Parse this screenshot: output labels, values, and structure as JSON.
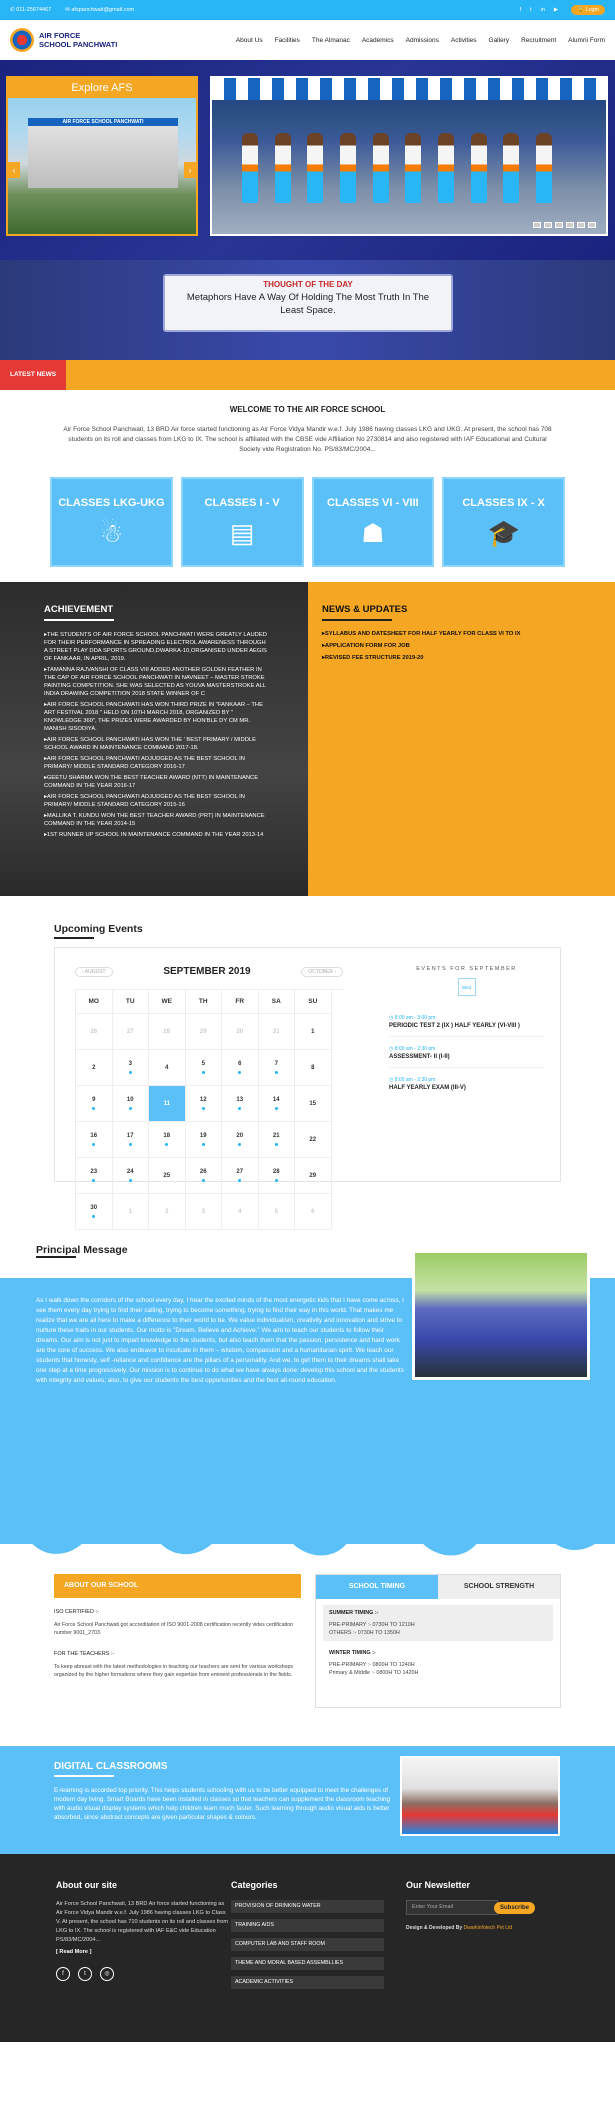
{
  "topbar": {
    "phone": "011-25674467",
    "email": "afspanchwati@gmail.com",
    "login": "Login"
  },
  "header": {
    "brand_line1": "AIR FORCE",
    "brand_line2": "SCHOOL PANCHWATI",
    "nav": [
      "About Us",
      "Facilities",
      "The Almanac",
      "Academics",
      "Admissions",
      "Activities",
      "Gallery",
      "Recruitment",
      "Alumni Form"
    ]
  },
  "hero": {
    "explore": "Explore AFS",
    "board": "AIR FORCE SCHOOL PANCHWATI"
  },
  "thought": {
    "heading": "THOUGHT OF THE DAY",
    "text": "Metaphors Have A Way Of Holding The Most Truth In The Least Space."
  },
  "latest_news": "LATEST NEWS",
  "welcome": {
    "title": "WELCOME TO THE AIR FORCE SCHOOL",
    "text": "Air Force School Panchwati, 13 BRD Air force started functioning as Air Force Vidya Mandir w.e.f. July 1986 having classes LKG and UKG. At present, the school has 708 students on its roll and classes from LKG to IX. The school is affiliated with the CBSE vide Affiliation No 2730814 and also registered with IAF Educational and Cultural Society vide Registration No. PS/83/MC/2004..."
  },
  "classes": [
    {
      "label": "CLASSES LKG-UKG",
      "icon": "☃"
    },
    {
      "label": "CLASSES I - V",
      "icon": "▤"
    },
    {
      "label": "CLASSES VI - VIII",
      "icon": "☗"
    },
    {
      "label": "CLASSES IX - X",
      "icon": "🎓"
    }
  ],
  "achievement": {
    "title": "ACHIEVEMENT",
    "items": [
      "The students of Air Force School Panchwati were greatly lauded for their performance in spreading electrol awareness through a street play DDA Sports Ground,Dwarka-10,organised under aegis of Fankaar, in April, 2019.",
      "Tamanna Rajvanshi of class VIII added another golden feather in the cap of Air Force School Panchwati in Navneet – Master Stroke Painting Competition. She was selected as Youva Masterstroke All India Drawing Competition 2018 state winner of C",
      "Air Force School Panchwati has won third prize in \"Fankaar – The Art Festival 2018 \" held on 10th March 2018, organized by \" Knowledge 360\", the prizes were awarded by Hon'ble Dy CM Mr. Manish Sisodiya.",
      "Air Force School Panchwati has won the ' Best Primary / Middle school award in Maintenance Command 2017-18.",
      "Air Force School Panchwati adjudged as the best school in Primary/ Middle standard category 2016-17",
      "Geetu Sharma won the Best Teacher Award (NTT) in Maintenance Command in the year 2016-17",
      "Air Force School Panchwati adjudged as the best school in Primary/ Middle standard category 2015-16",
      "Mallika T. Kundu won the Best Teacher Award (PRT) in Maintenance Command in the year 2014-15",
      "1st Runner Up School in Maintenance Command in the year 2013-14"
    ]
  },
  "news": {
    "title": "NEWS & UPDATES",
    "items": [
      "SYLLABUS AND DATESHEET FOR HALF YEARLY FOR CLASS VI TO IX",
      "APPLICATION FORM FOR JOB",
      "REVISED FEE STRUCTURE 2019-20"
    ]
  },
  "events": {
    "title": "Upcoming Events",
    "prev": "AUGUST",
    "month": "SEPTEMBER 2019",
    "next": "OCTOBER",
    "days": [
      "MO",
      "TU",
      "WE",
      "TH",
      "FR",
      "SA",
      "SU"
    ],
    "cells": [
      {
        "d": "26",
        "c": "o"
      },
      {
        "d": "27",
        "c": "o"
      },
      {
        "d": "28",
        "c": "o"
      },
      {
        "d": "29",
        "c": "o"
      },
      {
        "d": "30",
        "c": "o"
      },
      {
        "d": "31",
        "c": "o"
      },
      {
        "d": "1",
        "c": ""
      },
      {
        "d": "2",
        "c": ""
      },
      {
        "d": "3",
        "c": "d"
      },
      {
        "d": "4",
        "c": ""
      },
      {
        "d": "5",
        "c": "d"
      },
      {
        "d": "6",
        "c": "d"
      },
      {
        "d": "7",
        "c": "d"
      },
      {
        "d": "8",
        "c": ""
      },
      {
        "d": "9",
        "c": "d"
      },
      {
        "d": "10",
        "c": "d"
      },
      {
        "d": "11",
        "c": "t"
      },
      {
        "d": "12",
        "c": "d"
      },
      {
        "d": "13",
        "c": "d"
      },
      {
        "d": "14",
        "c": "d"
      },
      {
        "d": "15",
        "c": ""
      },
      {
        "d": "16",
        "c": "d"
      },
      {
        "d": "17",
        "c": "d"
      },
      {
        "d": "18",
        "c": "d"
      },
      {
        "d": "19",
        "c": "d"
      },
      {
        "d": "20",
        "c": "d"
      },
      {
        "d": "21",
        "c": "d"
      },
      {
        "d": "22",
        "c": ""
      },
      {
        "d": "23",
        "c": "d"
      },
      {
        "d": "24",
        "c": "d"
      },
      {
        "d": "25",
        "c": ""
      },
      {
        "d": "26",
        "c": "d"
      },
      {
        "d": "27",
        "c": "d"
      },
      {
        "d": "28",
        "c": "d"
      },
      {
        "d": "29",
        "c": ""
      },
      {
        "d": "30",
        "c": "d"
      },
      {
        "d": "1",
        "c": "o"
      },
      {
        "d": "2",
        "c": "o"
      },
      {
        "d": "3",
        "c": "o"
      },
      {
        "d": "4",
        "c": "o"
      },
      {
        "d": "5",
        "c": "o"
      },
      {
        "d": "6",
        "c": "o"
      }
    ],
    "list_heading": "EVENTS FOR SEPTEMBER",
    "day_box": "Wed",
    "items": [
      {
        "time": "8:00 am - 3:00 pm",
        "name": "PERIODIC TEST 2 (IX ) HALF YEARLY (VI-VIII )"
      },
      {
        "time": "8:00 am - 2:30 pm",
        "name": "ASSESSMENT- II (I-II)"
      },
      {
        "time": "8:00 am - 2:30 pm",
        "name": "HALF YEARLY EXAM (III-V)"
      }
    ]
  },
  "principal": {
    "title": "Principal Message",
    "text": "As I walk down the corridors of the school every day, I hear the excited minds of the most energetic kids that I have come across, I see them every day trying to find their calling, trying to become something, trying to find their way in this world. That makes me realize that we are all here to make a difference to their world to be. We value individualism, creativity and innovation and strive to nurture these traits in our students. Our motto is \"Dream, Believe and Achieve.\" We aim to teach our students to follow their dreams. Our aim is not just to impart knowledge to the students, but also teach them that the passion, persistence and hard work are the core of success. We also endeavor to inculcate in them – wisdom, compassion and a humanitarian spirit. We teach our students that honesty, self -reliance and confidence are the pillars of a personality. And we, to get them to their dreams shall take one step at a time progressively. Our mission is to continue to do what we have always done: develop this school and the students with integrity and values; also, to give our students the best opportunities and the best all-round education."
  },
  "about": {
    "title": "ABOUT OUR SCHOOL",
    "iso_label": "ISO CERTIFIED :-",
    "iso_text": "Air Force School Panchwati got accreditation of ISO 9001-2008 certification recently vides certification number 9001_2703.",
    "teachers_label": "FOR THE TEACHERS :-",
    "teachers_text": "To keep abreast with the latest methodologies in teaching our teachers are sent for various workshops organized by the higher formations where they gain expertise from eminent professionals in the fields."
  },
  "timing": {
    "tab1": "SCHOOL TIMING",
    "tab2": "SCHOOL STRENGTH",
    "summer_title": "SUMMER TIMING :-",
    "summer_1": "PRE-PRIMARY :- 0730H TO 1210H",
    "summer_2": "OTHERS :- 0730H TO 1350H",
    "winter_title": "WINTER TIMING :-",
    "winter_1": "PRE-PRIMARY :- 0800H TO 1240H",
    "winter_2": "Primary & Middle :- 0800H TO 1420H"
  },
  "digital": {
    "title": "DIGITAL CLASSROOMS",
    "text": "E-learning is accorded top priority. This helps students schooling with us to be better equipped to meet the challenges of modern day living. Smart Boards have been installed in classes so that teachers can supplement the classroom teaching with audio visual display systems which help children learn much faster. Such learning through audio visual aids is better absorbed, since abstract concepts are given particular shapes & colours."
  },
  "footer": {
    "about_title": "About our site",
    "about_text": "Air Force School Panchwati, 13 BRD Air force started functioning as Air Force Vidya Mandir w.e.f. July 1986 having classes LKG to Class V. At present, the school has 710 students on its roll and classes from LKG to IX. The school is registered with IAF E&C vide Education PS/83/MC/2004...",
    "read_more": "[ Read More ]",
    "cat_title": "Categories",
    "categories": [
      "PROVISION OF DRINKING WATER",
      "TRAINING AIDS",
      "COMPUTER LAB AND STAFF ROOM",
      "THEME AND MORAL BASED ASSEMBLLIES",
      "ACADEMIC ACTIVITIES"
    ],
    "news_title": "Our Newsletter",
    "email_placeholder": "Enter Your Email",
    "subscribe": "Subscribe",
    "dev_prefix": "Design & Developed By ",
    "dev_name": "Dwarkinfotech Pvt Ltd"
  }
}
